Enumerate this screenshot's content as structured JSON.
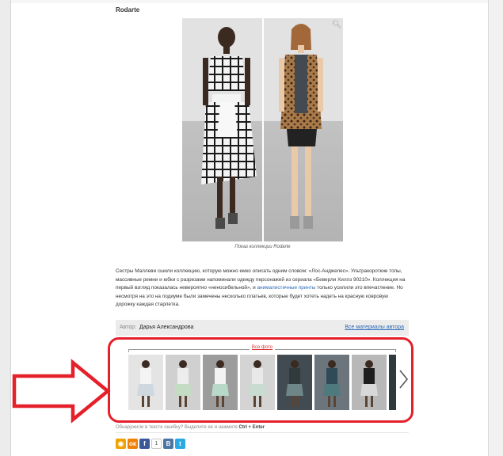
{
  "section": {
    "title": "Rodarte"
  },
  "photo": {
    "caption": "Показ коллекции Rodarte"
  },
  "article": {
    "text_before_link": "Сестры Маллеви сшили коллекцию, которую можно емко описать одним словом: «Лос-Анджелес». Ультракороткие топы, массивные ремни и юбки с разрезами напоминали одежду персонажей из сериала «Беверли Хиллз 90210». Коллекция на первый взгляд показалась невероятно «неносибельной», и ",
    "link_text": "анималистичные принты",
    "text_after_link": " только усилили это впечатление. Но несмотря на это на подиуме были замечены несколько платьев, которые будет хотеть надеть на красную ковровую дорожку каждая старлетка."
  },
  "author": {
    "label": "Автор:",
    "name": "Дарья Александрова",
    "all_link": "Все материалы автора"
  },
  "gallery": {
    "title": "Все фото",
    "accent": "#e5202a",
    "thumbs": [
      {
        "bg": "#e4e4e4",
        "fig": "#f4f4f4",
        "skirt": "#cfd8de",
        "alt": "Rodarte look 1"
      },
      {
        "bg": "#d0d0d0",
        "fig": "#ededed",
        "skirt": "#c4dcc4",
        "alt": "Rodarte look 2"
      },
      {
        "bg": "#9c9c9c",
        "fig": "#f2f2f2",
        "skirt": "#b8d8c8",
        "alt": "Rodarte look 3"
      },
      {
        "bg": "#d4d4d4",
        "fig": "#e9e9e9",
        "skirt": "#c8dcd2",
        "alt": "Rodarte look 4"
      },
      {
        "bg": "#424a52",
        "fig": "#2f3a3c",
        "skirt": "#6e8688",
        "alt": "Rodarte look 5"
      },
      {
        "bg": "#6c747c",
        "fig": "#2e4b57",
        "skirt": "#4e7a7e",
        "alt": "Rodarte look 6"
      },
      {
        "bg": "#b8b8b8",
        "fig": "#1e1e1e",
        "skirt": "#d8d8d8",
        "alt": "Rodarte look 7"
      },
      {
        "bg": "#2e3a3e",
        "fig": "#1a1a1a",
        "skirt": "#8ec2ba",
        "alt": "Rodarte look 8"
      },
      {
        "bg": "#585c60",
        "fig": "#2a2a2a",
        "skirt": "#707070",
        "alt": "Rodarte look 9"
      }
    ]
  },
  "annotation": {
    "arrow_color": "#e5202a"
  },
  "typo_note": {
    "text": "Обнаружили в тексте ошибку? Выделите ее и нажмите",
    "keys": "Ctrl + Enter"
  },
  "share": {
    "count": "1",
    "buttons": [
      {
        "icon": "rambler-icon",
        "color": "#f0a200",
        "glyph": "◉"
      },
      {
        "icon": "odnoklassniki-icon",
        "color": "#ee8208",
        "glyph": "ок"
      },
      {
        "icon": "facebook-icon",
        "color": "#3b5998",
        "glyph": "f"
      }
    ],
    "buttons_after": [
      {
        "icon": "vkontakte-icon",
        "color": "#4c75a3",
        "glyph": "В"
      },
      {
        "icon": "twitter-icon",
        "color": "#2ba9e1",
        "glyph": "t"
      }
    ]
  }
}
